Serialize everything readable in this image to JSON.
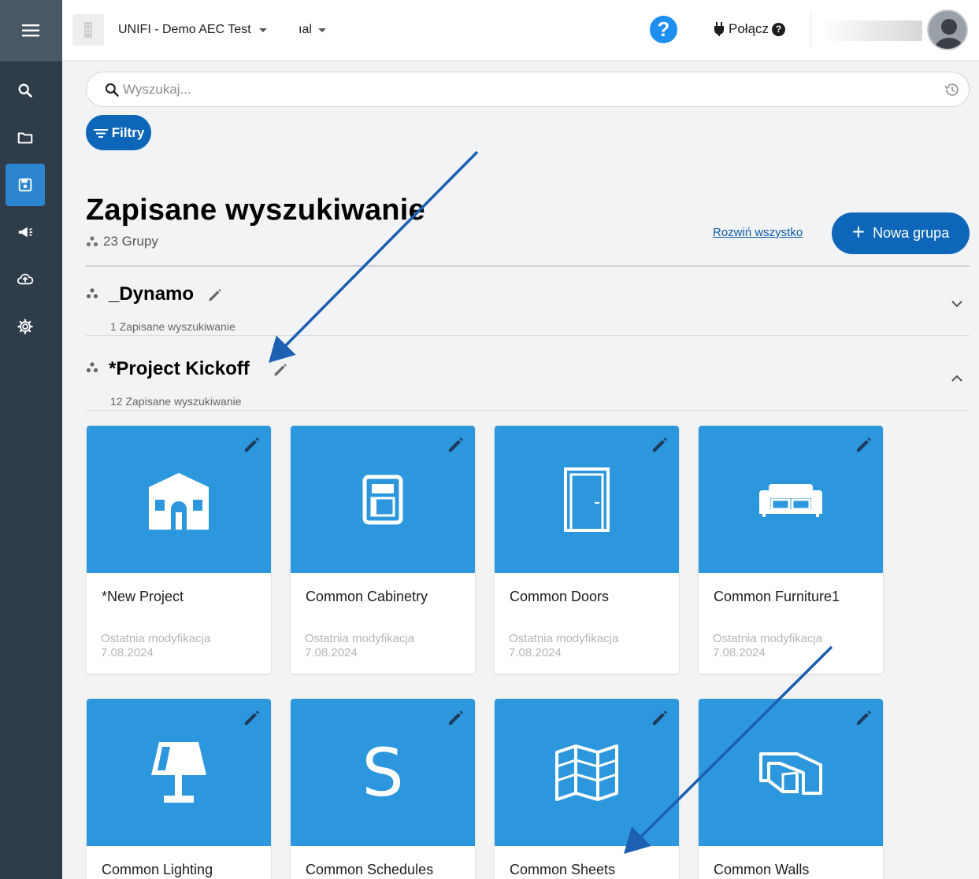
{
  "header": {
    "project": "UNIFI - Demo AEC Test",
    "section_partial": "ıal",
    "help_symbol": "?",
    "connect": "Połącz",
    "connect_help": "?"
  },
  "search": {
    "placeholder": "Wyszukaj..."
  },
  "filters_label": "Filtry",
  "page": {
    "title": "Zapisane wyszukiwanie",
    "groups_count": "23 Grupy",
    "expand_all": "Rozwiń wszystko",
    "new_group_plus": "+",
    "new_group": "Nowa grupa"
  },
  "groups": [
    {
      "name": "_Dynamo",
      "count": "1 Zapisane wyszukiwanie",
      "expanded": false
    },
    {
      "name": "*Project Kickoff",
      "count": "12 Zapisane wyszukiwanie",
      "expanded": true
    }
  ],
  "cards": [
    {
      "name": "*New Project",
      "modified_label": "Ostatnia modyfikacja",
      "modified_date": "7.08.2024",
      "icon": "house-icon"
    },
    {
      "name": "Common Cabinetry",
      "modified_label": "Ostatnia modyfikacja",
      "modified_date": "7.08.2024",
      "icon": "cabinet-icon"
    },
    {
      "name": "Common Doors",
      "modified_label": "Ostatnia modyfikacja",
      "modified_date": "7.08.2024",
      "icon": "door-icon"
    },
    {
      "name": "Common Furniture1",
      "modified_label": "Ostatnia modyfikacja",
      "modified_date": "7.08.2024",
      "icon": "sofa-icon"
    },
    {
      "name": "Common Lighting",
      "icon": "lamp-icon"
    },
    {
      "name": "Common Schedules",
      "icon_letter": "S",
      "icon": "schedule-icon"
    },
    {
      "name": "Common Sheets",
      "icon": "map-icon"
    },
    {
      "name": "Common Walls",
      "icon": "walls-icon"
    }
  ],
  "colors": {
    "sidebar": "#2f3d4a",
    "accent": "#0d66b8",
    "card_top": "#2d97dd",
    "annotation_arrow": "#1d5fb0"
  }
}
